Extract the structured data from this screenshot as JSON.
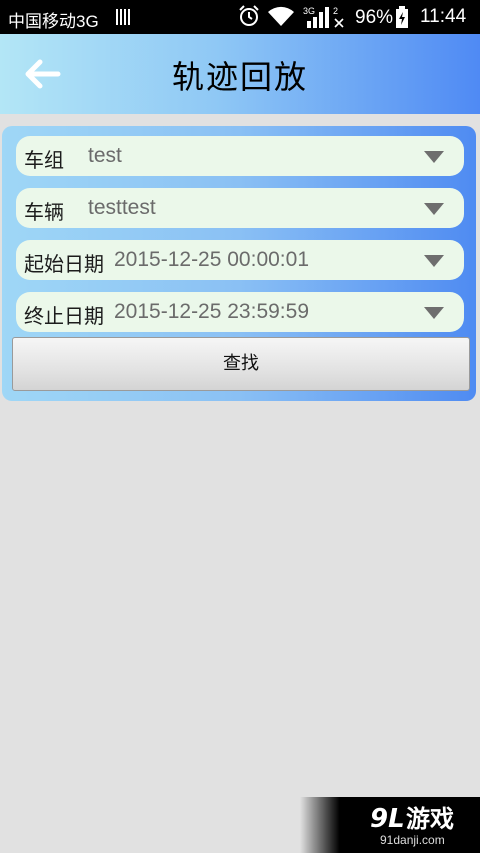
{
  "status_bar": {
    "carrier": "中国移动3G",
    "battery_percent": "96%",
    "time": "11:44",
    "icons": [
      "sim-icon",
      "alarm-icon",
      "wifi-icon",
      "signal-3g-icon",
      "signal-2g-icon",
      "battery-charging-icon"
    ]
  },
  "header": {
    "title": "轨迹回放",
    "back_icon": "back-arrow-icon"
  },
  "form": {
    "fields": [
      {
        "label": "车组",
        "value": "test"
      },
      {
        "label": "车辆",
        "value": "testtest"
      },
      {
        "label": "起始日期",
        "value": "2015-12-25 00:00:01"
      },
      {
        "label": "终止日期",
        "value": "2015-12-25 23:59:59"
      }
    ],
    "search_label": "查找"
  },
  "watermark": {
    "logo": "9L游戏",
    "site": "91danji.com"
  },
  "colors": {
    "header_gradient_start": "#b3e6f6",
    "header_gradient_end": "#4f8af4",
    "field_bg": "#ebf8ea",
    "page_bg": "#e1e1e1"
  }
}
